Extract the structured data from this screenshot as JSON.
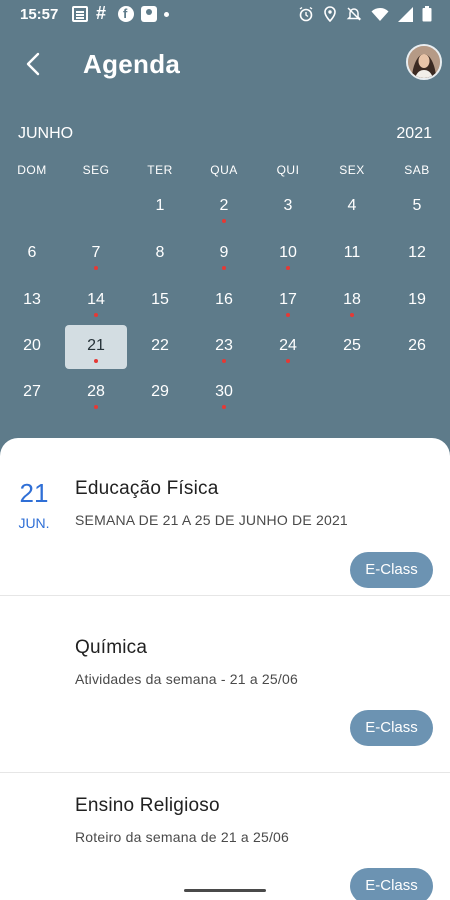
{
  "status_bar": {
    "time": "15:57"
  },
  "header": {
    "title": "Agenda"
  },
  "calendar": {
    "month": "JUNHO",
    "year": "2021",
    "weekdays": [
      "DOM",
      "SEG",
      "TER",
      "QUA",
      "QUI",
      "SEX",
      "SAB"
    ],
    "weeks": [
      [
        null,
        null,
        "1",
        "2",
        "3",
        "4",
        "5"
      ],
      [
        "6",
        "7",
        "8",
        "9",
        "10",
        "11",
        "12"
      ],
      [
        "13",
        "14",
        "15",
        "16",
        "17",
        "18",
        "19"
      ],
      [
        "20",
        "21",
        "22",
        "23",
        "24",
        "25",
        "26"
      ],
      [
        "27",
        "28",
        "29",
        "30",
        null,
        null,
        null
      ]
    ],
    "event_days": [
      "2",
      "7",
      "9",
      "10",
      "14",
      "17",
      "18",
      "21",
      "23",
      "24",
      "28",
      "30"
    ],
    "selected_day": "21",
    "event_dot_color": "#e53935"
  },
  "events": {
    "date_day": "21",
    "date_month": "JUN.",
    "items": [
      {
        "title": "Educação Física",
        "subtitle": "SEMANA DE 21 A 25 DE JUNHO DE 2021",
        "button": "E-Class"
      },
      {
        "title": "Química",
        "subtitle": "Atividades da semana - 21 a 25/06",
        "button": "E-Class"
      },
      {
        "title": "Ensino Religioso",
        "subtitle": "Roteiro da semana de 21 a 25/06",
        "button": "E-Class"
      }
    ]
  },
  "colors": {
    "header_bg": "#5e7b8a",
    "accent_blue": "#2f6fd6",
    "button_bg": "#6c93b2"
  }
}
